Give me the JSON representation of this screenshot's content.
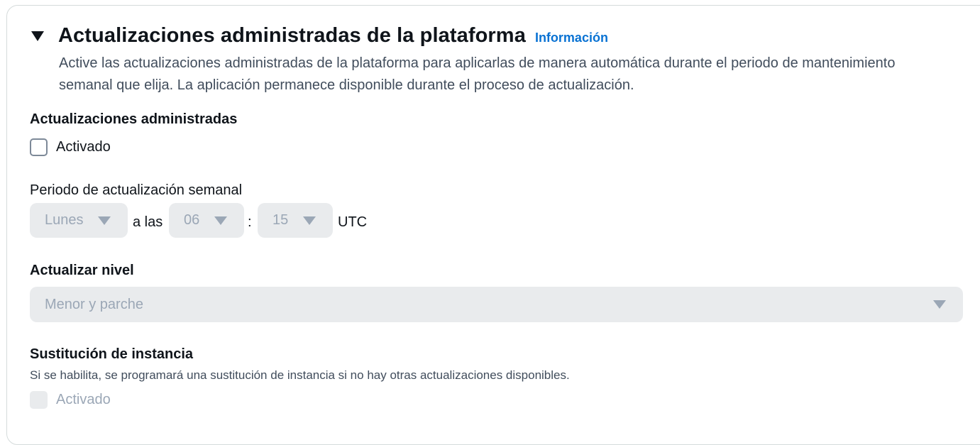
{
  "header": {
    "title": "Actualizaciones administradas de la plataforma",
    "info_link": "Información",
    "description": "Active las actualizaciones administradas de la plataforma para aplicarlas de manera automática durante el periodo de mantenimiento semanal que elija. La aplicación permanece disponible durante el proceso de actualización."
  },
  "managed_updates": {
    "label": "Actualizaciones administradas",
    "checkbox_label": "Activado",
    "checked": false
  },
  "weekly_window": {
    "label": "Periodo de actualización semanal",
    "day": "Lunes",
    "at_text": "a las",
    "hour": "06",
    "separator": ":",
    "minute": "15",
    "timezone": "UTC",
    "disabled": true
  },
  "update_level": {
    "label": "Actualizar nivel",
    "value": "Menor y parche",
    "disabled": true
  },
  "instance_replacement": {
    "label": "Sustitución de instancia",
    "help": "Si se habilita, se programará una sustitución de instancia si no hay otras actualizaciones disponibles.",
    "checkbox_label": "Activado",
    "disabled": true
  },
  "icons": {
    "caret": "caret-down-icon",
    "dropdown": "chevron-down-icon"
  },
  "colors": {
    "link": "#0972d3",
    "disabled_bg": "#e9ebed",
    "disabled_text": "#9ba7b6"
  }
}
